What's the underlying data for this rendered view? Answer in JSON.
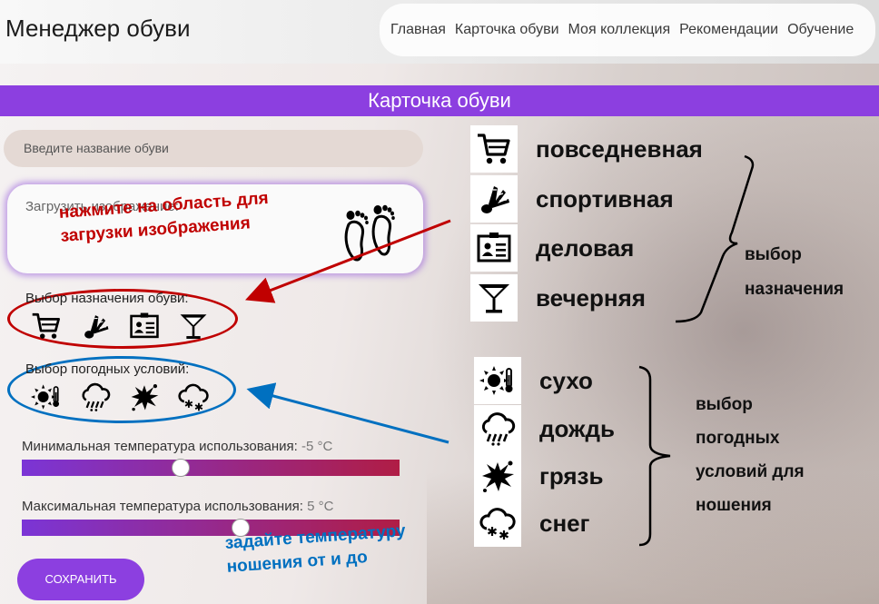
{
  "header": {
    "app_title": "Менеджер обуви",
    "nav": [
      "Главная",
      "Карточка обуви",
      "Моя коллекция",
      "Рекомендации",
      "Обучение"
    ]
  },
  "page_title": "Карточка обуви",
  "form": {
    "name_placeholder": "Введите название обуви",
    "upload_label": "Загрузить изображение:",
    "purpose_label": "Выбор назначения обуви:",
    "weather_label": "Выбор погодных условий:",
    "min_temp_label": "Минимальная температура использования:",
    "min_temp_value": "-5 °C",
    "min_temp_fraction": 0.42,
    "max_temp_label": "Максимальная температура использования:",
    "max_temp_value": "5 °C",
    "max_temp_fraction": 0.58,
    "save_label": "СОХРАНИТЬ"
  },
  "annotations": {
    "upload_note": [
      "нажмите на область для",
      "загрузки изображения"
    ],
    "temp_note": [
      "задайте температуру",
      "ношения от и до"
    ],
    "purpose_brace": [
      "выбор",
      "назначения"
    ],
    "weather_brace": [
      "выбор",
      "погодных",
      "условий для",
      "ношения"
    ]
  },
  "legend": {
    "purpose": [
      {
        "icon": "shopping-cart-icon",
        "label": "повседневная"
      },
      {
        "icon": "shuttlecock-icon",
        "label": "спортивная"
      },
      {
        "icon": "id-card-icon",
        "label": "деловая"
      },
      {
        "icon": "cocktail-glass-icon",
        "label": "вечерняя"
      }
    ],
    "weather": [
      {
        "icon": "sun-thermometer-icon",
        "label": "сухо"
      },
      {
        "icon": "rain-cloud-icon",
        "label": "дождь"
      },
      {
        "icon": "mud-splash-icon",
        "label": "грязь"
      },
      {
        "icon": "snow-cloud-icon",
        "label": "снег"
      }
    ]
  },
  "colors": {
    "accent": "#8c3fe0",
    "slider_start": "#7b35d6",
    "slider_end": "#b01d45",
    "note_red": "#c00000",
    "note_blue": "#0070c0"
  }
}
